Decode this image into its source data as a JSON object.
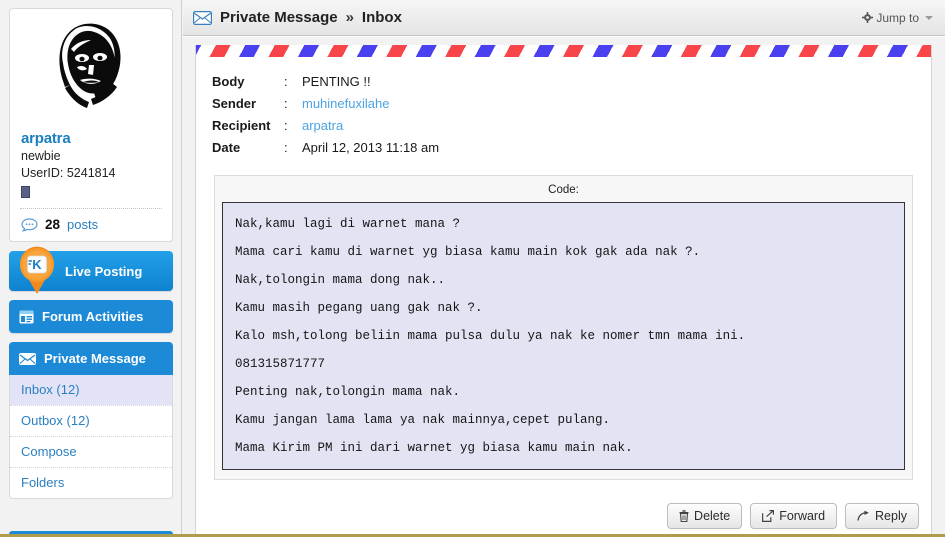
{
  "topbar": {
    "icon": "envelope-icon",
    "title": "Private Message",
    "separator": "»",
    "section": "Inbox",
    "jump_to_label": "Jump to",
    "jump_to_icon": "gear-icon",
    "jump_to_caret": "chevron-down-icon"
  },
  "sidebar": {
    "profile": {
      "avatar_alt": "user-avatar",
      "username": "arpatra",
      "rank": "newbie",
      "userid_label": "UserID: 5241814",
      "badge_icon": "rank-badge-icon",
      "posts_icon": "comment-bubble-icon",
      "posts_count": "28",
      "posts_label": "posts"
    },
    "nav": [
      {
        "label": "Live Posting",
        "icon": "live-posting-pin-icon",
        "style": "pin"
      },
      {
        "label": "Forum Activities",
        "icon": "forum-window-icon",
        "style": "plain"
      },
      {
        "label": "Private Message",
        "icon": "envelope-icon",
        "style": "plain"
      }
    ],
    "submenu": [
      {
        "label": "Inbox (12)",
        "active": true
      },
      {
        "label": "Outbox (12)",
        "active": false
      },
      {
        "label": "Compose",
        "active": false
      },
      {
        "label": "Folders",
        "active": false
      }
    ]
  },
  "message": {
    "fields": [
      {
        "label": "Body",
        "colon": ":",
        "value": "PENTING !!",
        "link": false
      },
      {
        "label": "Sender",
        "colon": ":",
        "value": "muhinefuxilahe",
        "link": true
      },
      {
        "label": "Recipient",
        "colon": ":",
        "value": "arpatra",
        "link": true
      },
      {
        "label": "Date",
        "colon": ":",
        "value": "April 12, 2013 11:18 am",
        "link": false
      }
    ],
    "code_caption": "Code:",
    "code_lines": [
      "Nak,kamu lagi di warnet mana ?",
      "Mama cari kamu di warnet yg biasa kamu main kok gak ada nak ?.",
      "Nak,tolongin mama dong nak..",
      "Kamu masih pegang uang gak nak ?.",
      "Kalo msh,tolong beliin mama pulsa dulu ya nak ke nomer tmn mama ini.",
      "081315871777",
      "Penting nak,tolongin mama nak.",
      "Kamu jangan lama lama ya nak mainnya,cepet pulang.",
      "Mama Kirim PM ini dari warnet yg biasa kamu main nak."
    ]
  },
  "actions": [
    {
      "label": "Delete",
      "icon": "trash-icon"
    },
    {
      "label": "Forward",
      "icon": "forward-icon"
    },
    {
      "label": "Reply",
      "icon": "reply-arrow-icon"
    }
  ],
  "colors": {
    "accent_blue": "#1c8ad6",
    "link_blue": "#2a7fc0",
    "stripe_red": "#f7454a",
    "stripe_blue": "#4b40f0",
    "code_bg": "#e2e3f3",
    "active_item_bg": "#e3e3f7"
  }
}
